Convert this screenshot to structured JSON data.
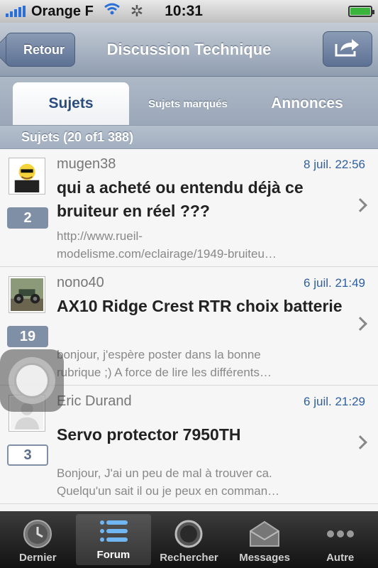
{
  "status_bar": {
    "carrier": "Orange F",
    "time": "10:31"
  },
  "nav": {
    "back_label": "Retour",
    "title": "Discussion Technique"
  },
  "tabs": [
    {
      "label": "Sujets",
      "active": true
    },
    {
      "label": "Sujets marqués",
      "active": false
    },
    {
      "label": "Annonces",
      "active": false
    }
  ],
  "section_header": "Sujets (20 of1 388)",
  "topics": [
    {
      "author": "mugen38",
      "date": "8 juil. 22:56",
      "title": "qui a acheté ou entendu déjà ce bruiteur en réel  ???",
      "preview_line1": "http://www.rueil-",
      "preview_line2": "modelisme.com/eclairage/1949-bruiteu…",
      "reply_count": "2",
      "unread": true,
      "avatar_icon": "cartoon-avatar-icon"
    },
    {
      "author": "nono40",
      "date": "6 juil. 21:49",
      "title": "AX10 Ridge Crest RTR choix batterie",
      "preview_line1": "bonjour, j'espère poster dans la bonne",
      "preview_line2": "rubrique ;)  A force de lire les différents…",
      "reply_count": "19",
      "unread": true,
      "avatar_icon": "rc-car-avatar-icon"
    },
    {
      "author": "Eric Durand",
      "date": "6 juil. 21:29",
      "title": "Servo protector 7950TH",
      "preview_line1": "Bonjour, J'ai un peu de mal à trouver ca.",
      "preview_line2": "Quelqu'un sait il ou je peux en comman…",
      "reply_count": "3",
      "unread": false,
      "avatar_icon": "default-user-avatar-icon"
    }
  ],
  "tab_bar": [
    {
      "label": "Dernier",
      "icon": "clock-icon",
      "active": false
    },
    {
      "label": "Forum",
      "icon": "list-icon",
      "active": true
    },
    {
      "label": "Rechercher",
      "icon": "search-icon",
      "active": false
    },
    {
      "label": "Messages",
      "icon": "envelope-icon",
      "active": false
    },
    {
      "label": "Autre",
      "icon": "more-icon",
      "active": false
    }
  ],
  "colors": {
    "link_date": "#2e5ea3",
    "badge": "#7e8fa6",
    "nav_gradient_top": "#c4ccd6",
    "nav_gradient_bottom": "#8f9db0"
  }
}
